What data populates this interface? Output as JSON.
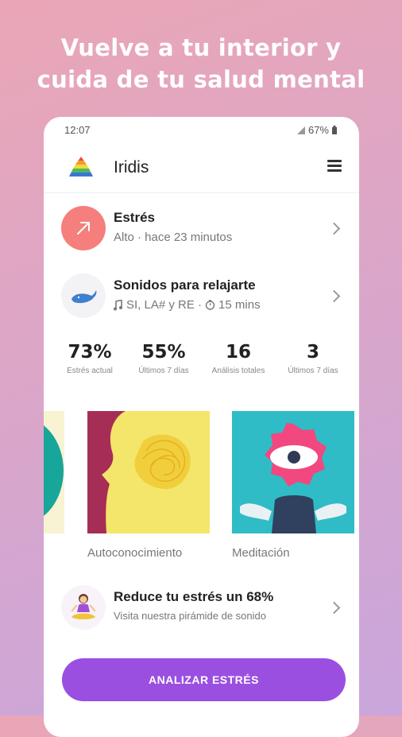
{
  "headline": [
    "Vuelve a tu interior y",
    "cuida de tu salud mental"
  ],
  "status": {
    "time": "12:07",
    "battery": "67%"
  },
  "app": {
    "title": "Iridis"
  },
  "rows": {
    "stress": {
      "title": "Estrés",
      "subtitle": "Alto · hace 23 minutos"
    },
    "sounds": {
      "title": "Sonidos para relajarte",
      "notes": "SI, LA# y RE ·",
      "duration": "15 mins"
    }
  },
  "stats": [
    {
      "value": "73%",
      "label": "Estrés actual"
    },
    {
      "value": "55%",
      "label": "Últimos 7 días"
    },
    {
      "value": "16",
      "label": "Análisis totales"
    },
    {
      "value": "3",
      "label": "Últimos 7 días"
    }
  ],
  "cards": [
    {
      "label": "Autoconocimiento"
    },
    {
      "label": "Meditación"
    }
  ],
  "promo": {
    "title": "Reduce tu estrés un 68%",
    "subtitle": "Visita nuestra pirámide de sonido"
  },
  "cta": {
    "label": "ANALIZAR ESTRÉS"
  },
  "colors": {
    "accent": "#9b4fe0",
    "stress_icon_bg": "#f47f7c",
    "teal": "#2fbcc6",
    "yellow": "#f3e66a",
    "pink": "#f1487f"
  }
}
